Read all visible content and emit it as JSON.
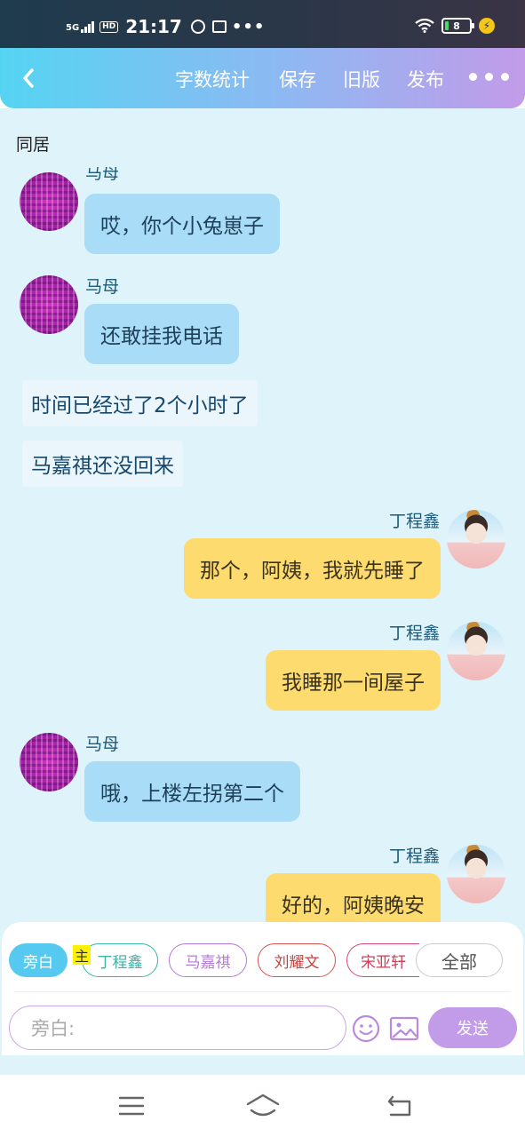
{
  "status_bar": {
    "network": "5G",
    "hd": "HD",
    "time": "21:17",
    "more": "•••",
    "battery": "8",
    "icons": [
      "signal-icon",
      "hd-icon",
      "nfc-icon",
      "calendar-icon",
      "wifi-icon",
      "battery-icon",
      "charging-icon"
    ]
  },
  "header": {
    "back_icon": "chevron-left-icon",
    "word_count": "字数统计",
    "save": "保存",
    "old_version": "旧版",
    "publish": "发布",
    "more_icon": "more-horizontal-icon"
  },
  "document": {
    "title": "同居"
  },
  "messages": [
    {
      "type": "left",
      "speaker": "马母",
      "text": "哎，你个小兔崽子"
    },
    {
      "type": "left",
      "speaker": "马母",
      "text": "还敢挂我电话"
    },
    {
      "type": "narration",
      "text": "时间已经过了2个小时了"
    },
    {
      "type": "narration",
      "text": "马嘉祺还没回来"
    },
    {
      "type": "right",
      "speaker": "丁程鑫",
      "text": "那个，阿姨，我就先睡了"
    },
    {
      "type": "right",
      "speaker": "丁程鑫",
      "text": "我睡那一间屋子"
    },
    {
      "type": "left",
      "speaker": "马母",
      "text": "哦，上楼左拐第二个"
    },
    {
      "type": "right",
      "speaker": "丁程鑫",
      "text": "好的，阿姨晚安"
    }
  ],
  "composer": {
    "roles": [
      {
        "label": "旁白",
        "color": "#55c9ef",
        "selected": true
      },
      {
        "label": "丁程鑫",
        "color": "#3bb3a5"
      },
      {
        "label": "马嘉祺",
        "color": "#b57ad3"
      },
      {
        "label": "刘耀文",
        "color": "#d9534f"
      },
      {
        "label": "宋亚轩",
        "color": "#d9467a"
      },
      {
        "label": "全部",
        "color": "#cccccc"
      }
    ],
    "main_badge": "主",
    "input_placeholder": "旁白:",
    "emoji_icon": "smiley-icon",
    "image_icon": "image-icon",
    "send": "发送"
  },
  "nav_bar": {
    "icons": [
      "menu-icon",
      "home-icon",
      "back-icon"
    ]
  }
}
